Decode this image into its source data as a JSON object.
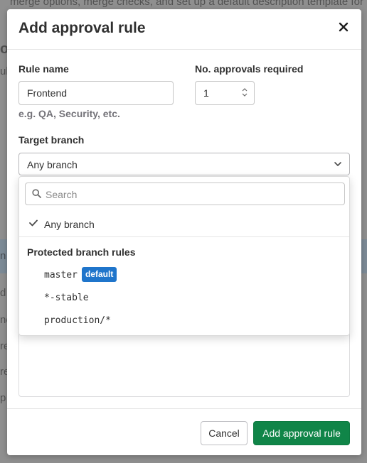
{
  "background": {
    "lines": [
      "merge options, merge checks, and set up a default description template for merg",
      "ov",
      "ul",
      "n C",
      "d a",
      "ne",
      "re",
      "re",
      "p"
    ]
  },
  "modal": {
    "title": "Add approval rule",
    "rule_name": {
      "label": "Rule name",
      "value": "Frontend",
      "hint": "e.g. QA, Security, etc."
    },
    "approvals": {
      "label": "No. approvals required",
      "value": "1"
    },
    "target_branch": {
      "label": "Target branch",
      "selected": "Any branch"
    },
    "dropdown": {
      "search_placeholder": "Search",
      "any_branch_label": "Any branch",
      "section_header": "Protected branch rules",
      "branches": [
        {
          "name": "master",
          "badge": "default"
        },
        {
          "name": "*-stable"
        },
        {
          "name": "production/*"
        }
      ]
    },
    "footer": {
      "cancel_label": "Cancel",
      "submit_label": "Add approval rule"
    }
  },
  "colors": {
    "primary": "#108548",
    "badge": "#1f75cb",
    "backdrop": "#8f8f8f"
  },
  "icons": [
    "close-icon",
    "chevron-down-icon",
    "search-icon",
    "check-icon",
    "stepper-icon"
  ]
}
